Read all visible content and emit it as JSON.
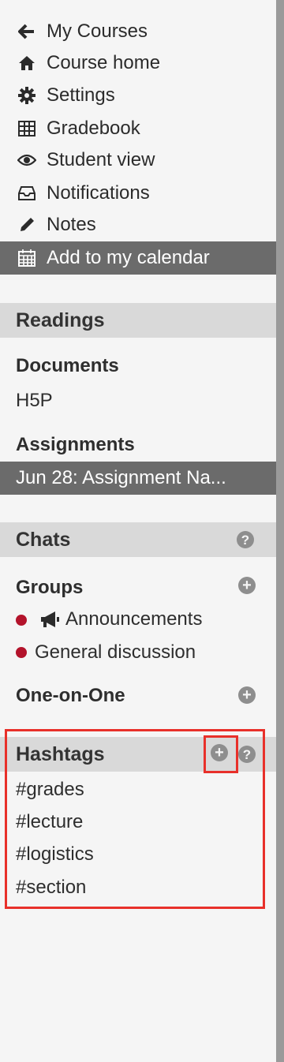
{
  "nav": {
    "items": [
      {
        "label": "My Courses",
        "icon": "arrow-left-icon"
      },
      {
        "label": "Course home",
        "icon": "home-icon"
      },
      {
        "label": "Settings",
        "icon": "gear-icon"
      },
      {
        "label": "Gradebook",
        "icon": "table-icon"
      },
      {
        "label": "Student view",
        "icon": "eye-icon"
      },
      {
        "label": "Notifications",
        "icon": "inbox-icon"
      },
      {
        "label": "Notes",
        "icon": "pencil-icon"
      },
      {
        "label": "Add to my calendar",
        "icon": "calendar-icon",
        "active": true
      }
    ]
  },
  "readings": {
    "title": "Readings",
    "documents_label": "Documents",
    "document_item": "H5P",
    "assignments_label": "Assignments",
    "assignment_item": "Jun 28: Assignment Na..."
  },
  "chats": {
    "title": "Chats",
    "groups_label": "Groups",
    "groups": [
      "Announcements",
      "General discussion"
    ],
    "one_on_one_label": "One-on-One"
  },
  "hashtags": {
    "title": "Hashtags",
    "items": [
      "#grades",
      "#lecture",
      "#logistics",
      "#section"
    ]
  },
  "colors": {
    "active_bg": "#6b6b6b",
    "section_bg": "#d9d9d9",
    "unread_dot": "#b3132b",
    "annotation": "#e8302a"
  }
}
